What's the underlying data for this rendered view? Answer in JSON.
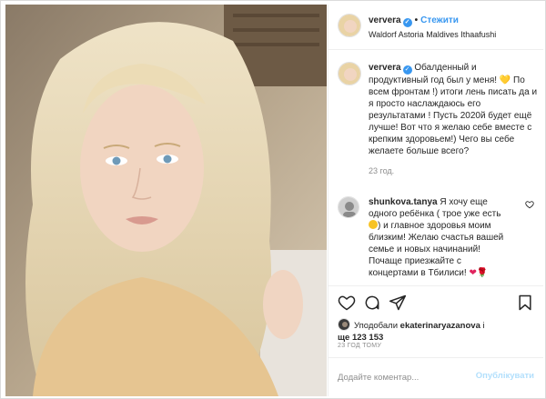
{
  "post": {
    "photo_alt": "",
    "icon": "user-photo"
  },
  "header": {
    "username": "ververa",
    "verified_icon": "check-icon",
    "separator": "•",
    "follow_label": "Стежити",
    "location": "Waldorf Astoria Maldives Ithaafushi"
  },
  "caption": {
    "username": "ververa",
    "text": "Обалденный и продуктивный год был у меня! 💛 По всем фронтам !) итоги лень писать да и я просто наслаждаюсь его результатами ! Пусть 2020й будет ещё лучше! Вот что я желаю себе вместе с крепким здоровьем!) Чего вы себе желаете больше всего?",
    "age": "23 год."
  },
  "comment": {
    "username": "shunkova.tanya",
    "text_1": "Я хочу еще одного ребёнка ( трое уже есть",
    "text_2": ") и главное здоровья моим близким! Желаю счастья вашей семье и новых начинаний! Почаще приезжайте с концертами в Тбилиси!",
    "heart_emoji": "❤",
    "rose_emoji": "🌹"
  },
  "likes": {
    "prefix": "Уподобали ",
    "liker": "ekaterinaryazanova",
    "suffix": " і",
    "more": "ще 123 153"
  },
  "time_label": "23 ГОД ТОМУ",
  "add_comment": {
    "placeholder": "Додайте коментар...",
    "post_label": "Опублікувати"
  },
  "colors": {
    "link": "#3897f0",
    "post_disabled": "#b2dffc",
    "muted": "#8e8e8e"
  }
}
